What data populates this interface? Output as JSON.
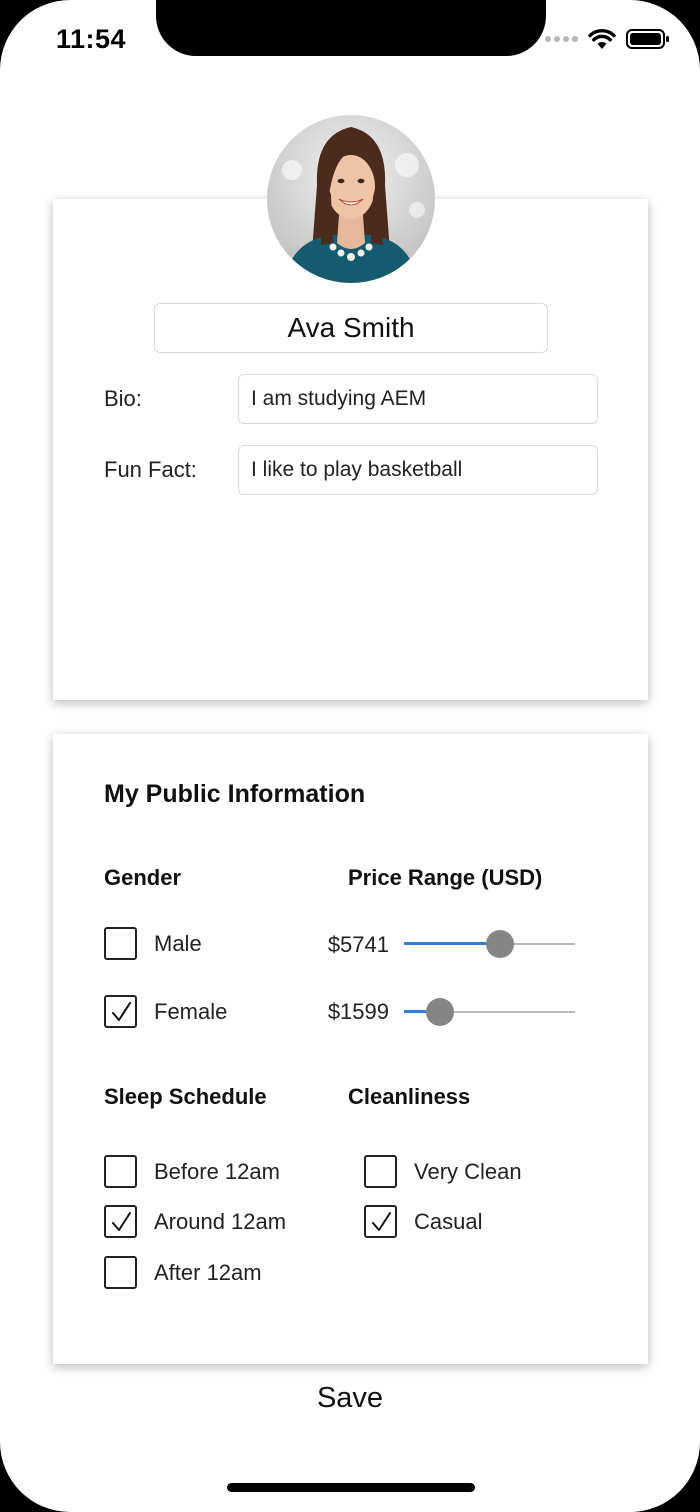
{
  "status_bar": {
    "time": "11:54"
  },
  "profile": {
    "name": "Ava Smith",
    "bio_label": "Bio:",
    "bio_value": "I am studying AEM",
    "fun_fact_label": "Fun Fact:",
    "fun_fact_value": "I like to play basketball"
  },
  "public_info": {
    "title": "My Public Information",
    "gender": {
      "heading": "Gender",
      "options": [
        {
          "label": "Male",
          "checked": false
        },
        {
          "label": "Female",
          "checked": true
        }
      ]
    },
    "price_range": {
      "heading": "Price Range (USD)",
      "sliders": [
        {
          "label": "$5741",
          "fraction": 0.56
        },
        {
          "label": "$1599",
          "fraction": 0.21
        }
      ]
    },
    "sleep_schedule": {
      "heading": "Sleep Schedule",
      "options": [
        {
          "label": "Before 12am",
          "checked": false
        },
        {
          "label": "Around 12am",
          "checked": true
        },
        {
          "label": "After 12am",
          "checked": false
        }
      ]
    },
    "cleanliness": {
      "heading": "Cleanliness",
      "options": [
        {
          "label": "Very Clean",
          "checked": false
        },
        {
          "label": "Casual",
          "checked": true
        }
      ]
    }
  },
  "save_label": "Save",
  "colors": {
    "slider_fill": "#2f7fd6",
    "slider_thumb": "#848484",
    "slider_track": "#b8b8b8"
  }
}
